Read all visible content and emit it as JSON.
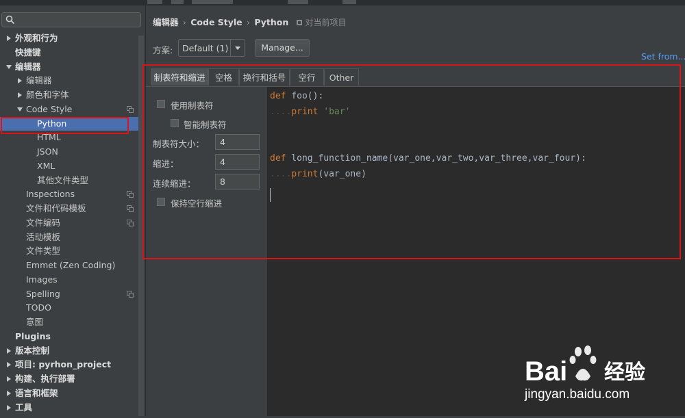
{
  "search": {
    "placeholder": ""
  },
  "sidebar": {
    "items": [
      {
        "label": "外观和行为",
        "arrow": "right",
        "bold": true
      },
      {
        "label": "快捷键",
        "arrow": "none",
        "bold": true
      },
      {
        "label": "编辑器",
        "arrow": "down",
        "bold": true
      },
      {
        "label": "编辑器",
        "arrow": "right",
        "bold": false
      },
      {
        "label": "颜色和字体",
        "arrow": "right",
        "bold": false
      },
      {
        "label": "Code Style",
        "arrow": "down",
        "bold": false,
        "copy": true
      },
      {
        "label": "Python",
        "arrow": "none",
        "bold": false,
        "selected": true
      },
      {
        "label": "HTML",
        "arrow": "none",
        "bold": false
      },
      {
        "label": "JSON",
        "arrow": "none",
        "bold": false
      },
      {
        "label": "XML",
        "arrow": "none",
        "bold": false
      },
      {
        "label": "其他文件类型",
        "arrow": "none",
        "bold": false
      },
      {
        "label": "Inspections",
        "arrow": "none",
        "bold": false,
        "copy": true
      },
      {
        "label": "文件和代码模板",
        "arrow": "none",
        "bold": false,
        "copy": true
      },
      {
        "label": "文件编码",
        "arrow": "none",
        "bold": false,
        "copy": true
      },
      {
        "label": "活动模板",
        "arrow": "none",
        "bold": false
      },
      {
        "label": "文件类型",
        "arrow": "none",
        "bold": false
      },
      {
        "label": "Emmet (Zen Coding)",
        "arrow": "none",
        "bold": false
      },
      {
        "label": "Images",
        "arrow": "none",
        "bold": false
      },
      {
        "label": "Spelling",
        "arrow": "none",
        "bold": false,
        "copy": true
      },
      {
        "label": "TODO",
        "arrow": "none",
        "bold": false
      },
      {
        "label": "意图",
        "arrow": "none",
        "bold": false
      },
      {
        "label": "Plugins",
        "arrow": "none",
        "bold": true
      },
      {
        "label": "版本控制",
        "arrow": "right",
        "bold": true
      },
      {
        "label": "项目: pyrhon_project",
        "arrow": "right",
        "bold": true
      },
      {
        "label": "构建、执行部署",
        "arrow": "right",
        "bold": true
      },
      {
        "label": "语言和框架",
        "arrow": "right",
        "bold": true
      },
      {
        "label": "工具",
        "arrow": "right",
        "bold": true
      }
    ]
  },
  "breadcrumb": {
    "part1": "编辑器",
    "part2": "Code Style",
    "part3": "Python",
    "sep": "›",
    "project_note": "对当前项目"
  },
  "scheme": {
    "label": "方案:",
    "value": "Default (1)",
    "manage": "Manage..."
  },
  "set_from": "Set from...",
  "tabs": [
    {
      "label": "制表符和缩进",
      "active": true
    },
    {
      "label": "空格"
    },
    {
      "label": "换行和括号"
    },
    {
      "label": "空行"
    },
    {
      "label": "Other"
    }
  ],
  "settings": {
    "use_tab": "使用制表符",
    "smart_tab": "智能制表符",
    "tab_size_label": "制表符大小：",
    "tab_size": "4",
    "indent_label": "缩进：",
    "indent": "4",
    "cont_indent_label": "连续缩进：",
    "cont_indent": "8",
    "keep_indent": "保持空行缩进"
  },
  "code": {
    "l1_kw": "def",
    "l1_rest": " foo():",
    "l2_dots": "....",
    "l2_kw": "print",
    "l2_str": " 'bar'",
    "l3_kw": "def",
    "l3_rest": " long_function_name(var_one,var_two,var_three,var_four):",
    "l4_dots": "....",
    "l4_kw": "print",
    "l4_rest": "(var_one)"
  },
  "watermark": {
    "brand": "Bai",
    "brand2": "经验",
    "url": "jingyan.baidu.com"
  },
  "colors": {
    "accent": "#4b6eaf",
    "highlight_box": "#d9141a",
    "keyword": "#cc7832",
    "string": "#6a8759",
    "link": "#589df6"
  }
}
